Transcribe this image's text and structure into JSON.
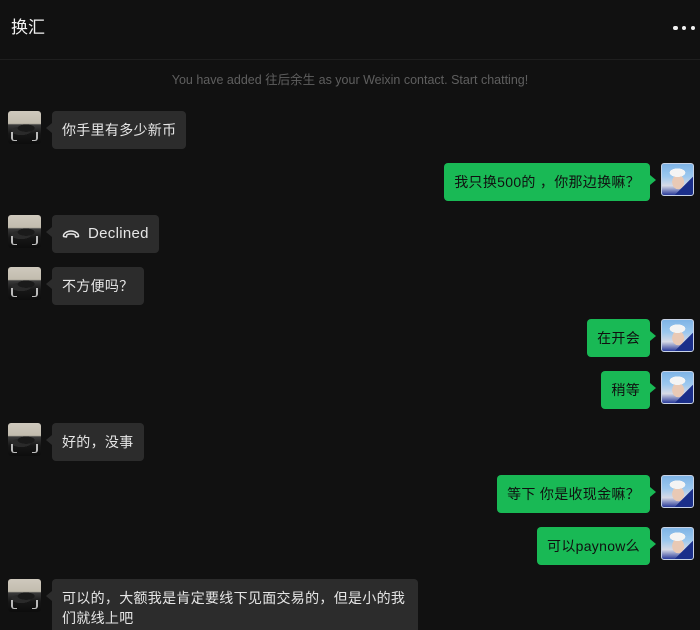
{
  "header": {
    "title": "换汇",
    "more_icon": "more-horizontal-icon"
  },
  "system_message": "You have added 往后余生 as your Weixin contact. Start chatting!",
  "messages": [
    {
      "sender": "contact",
      "text": "你手里有多少新币"
    },
    {
      "sender": "me",
      "text": "我只换500的 ，你那边换嘛？"
    },
    {
      "sender": "contact",
      "type": "call",
      "icon": "phone-hangup-icon",
      "text": "Declined"
    },
    {
      "sender": "contact",
      "text": "不方便吗？"
    },
    {
      "sender": "me",
      "text": "在开会"
    },
    {
      "sender": "me",
      "text": "稍等"
    },
    {
      "sender": "contact",
      "text": "好的，没事"
    },
    {
      "sender": "me",
      "text": "等下 你是收现金嘛？"
    },
    {
      "sender": "me",
      "text": "可以paynow么"
    },
    {
      "sender": "contact",
      "text": "可以的，大额我是肯定要线下见面交易的，但是小的我们就线上吧"
    }
  ],
  "colors": {
    "background": "#111111",
    "incoming_bubble": "#2c2c2c",
    "outgoing_bubble": "#19b955",
    "system_text": "#5f5f5f"
  }
}
